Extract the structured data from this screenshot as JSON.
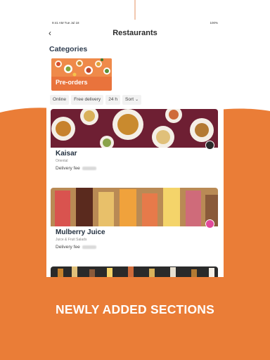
{
  "device": {
    "status": {
      "time": "9:41 AM  Tue Jul 18",
      "battery": "100%"
    },
    "nav": {
      "title": "Restaurants"
    },
    "categories": {
      "title": "Categories",
      "items": [
        {
          "label": "Pre-orders"
        }
      ]
    },
    "filters": [
      "Online",
      "Free delivery",
      "24 h",
      "Sort"
    ],
    "restaurants": [
      {
        "name": "Kaisar",
        "cuisine": "Oriental",
        "delivery_label": "Delivery fee"
      },
      {
        "name": "Mulberry Juice",
        "cuisine": "Juice & Fruit Salads",
        "delivery_label": "Delivery fee"
      }
    ]
  },
  "promo": {
    "caption": "NEWLY ADDED SECTIONS"
  },
  "colors": {
    "accent": "#ea7d37",
    "title_text": "#2f3d50"
  },
  "icons": [
    "back-chevron-icon",
    "chevron-down-icon"
  ]
}
